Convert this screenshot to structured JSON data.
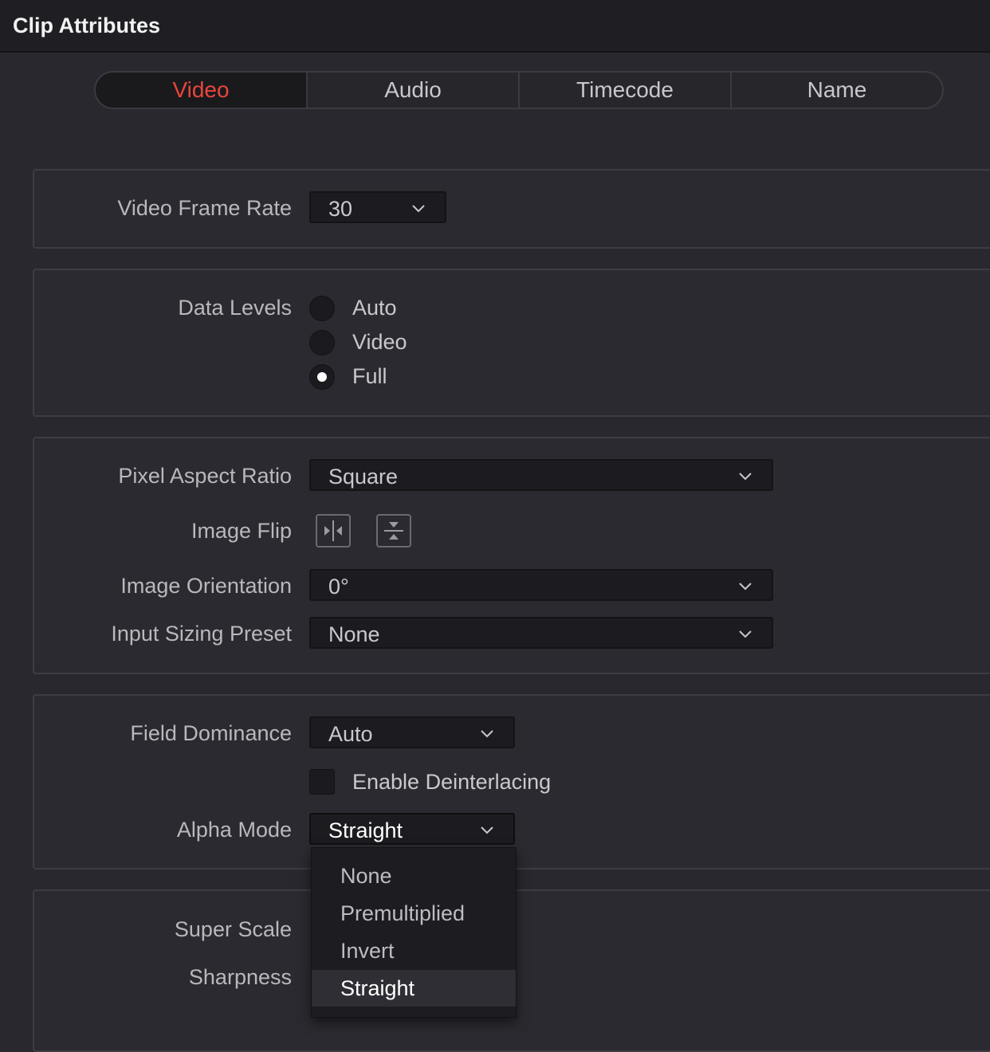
{
  "window": {
    "title": "Clip Attributes"
  },
  "tabs": [
    {
      "label": "Video",
      "active": true
    },
    {
      "label": "Audio"
    },
    {
      "label": "Timecode"
    },
    {
      "label": "Name"
    }
  ],
  "frame_rate": {
    "label": "Video Frame Rate",
    "value": "30"
  },
  "data_levels": {
    "label": "Data Levels",
    "options": [
      "Auto",
      "Video",
      "Full"
    ],
    "selected": "Full"
  },
  "pixel_aspect": {
    "label": "Pixel Aspect Ratio",
    "value": "Square"
  },
  "image_flip": {
    "label": "Image Flip",
    "icons": [
      "flip-horizontal-icon",
      "flip-vertical-icon"
    ]
  },
  "image_orientation": {
    "label": "Image Orientation",
    "value": "0°"
  },
  "input_sizing": {
    "label": "Input Sizing Preset",
    "value": "None"
  },
  "field_dominance": {
    "label": "Field Dominance",
    "value": "Auto"
  },
  "deinterlacing": {
    "label": "Enable Deinterlacing",
    "checked": false
  },
  "alpha_mode": {
    "label": "Alpha Mode",
    "value": "Straight",
    "options": [
      "None",
      "Premultiplied",
      "Invert",
      "Straight"
    ],
    "selected": "Straight"
  },
  "super_scale": {
    "label": "Super Scale"
  },
  "sharpness": {
    "label": "Sharpness"
  },
  "colors": {
    "accent": "#e8463b",
    "background": "#28282e",
    "panel": "#2a2a30"
  }
}
